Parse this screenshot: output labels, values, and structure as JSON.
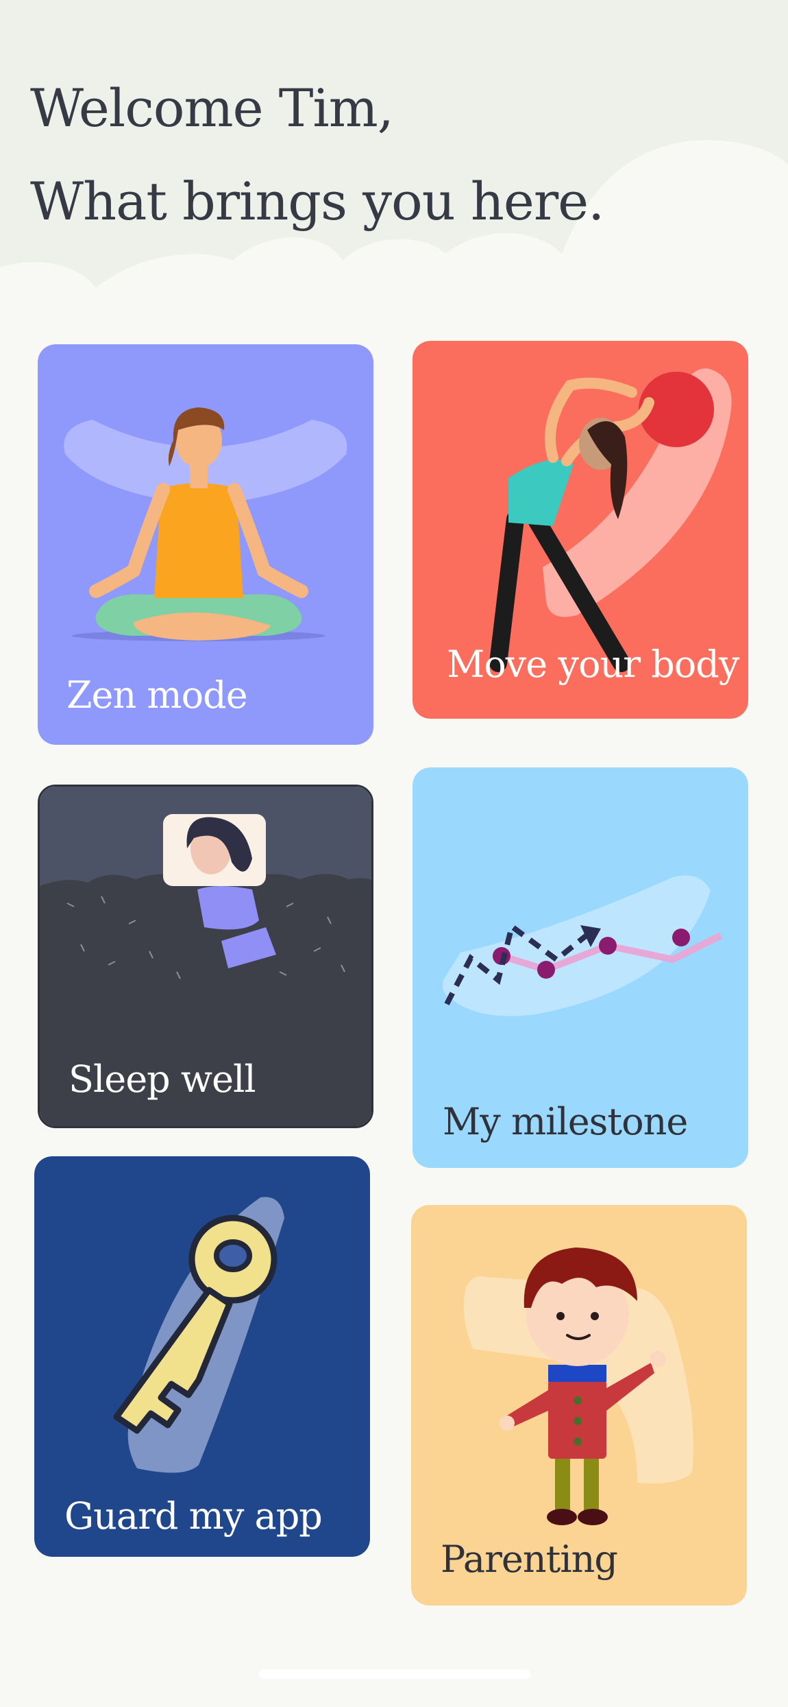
{
  "greeting": {
    "line1": "Welcome Tim,",
    "line2": "What brings you here."
  },
  "cards": [
    {
      "id": "zen",
      "label": "Zen mode",
      "color": "#8f98fb",
      "label_color": "#ffffff",
      "illustration": "meditation-icon"
    },
    {
      "id": "move",
      "label": "Move your body",
      "color": "#fb6d5c",
      "label_color": "#ffffff",
      "illustration": "stretching-icon"
    },
    {
      "id": "sleep",
      "label": "Sleep well",
      "color": "#3e4049",
      "label_color": "#ffffff",
      "illustration": "sleeping-icon"
    },
    {
      "id": "milestone",
      "label": "My milestone",
      "color": "#9bd8fd",
      "label_color": "#2f323b",
      "illustration": "progress-chart-icon"
    },
    {
      "id": "guard",
      "label": "Guard my app",
      "color": "#20468c",
      "label_color": "#ffffff",
      "illustration": "key-icon"
    },
    {
      "id": "parent",
      "label": "Parenting",
      "color": "#fbd393",
      "label_color": "#2f323b",
      "illustration": "child-icon"
    }
  ]
}
